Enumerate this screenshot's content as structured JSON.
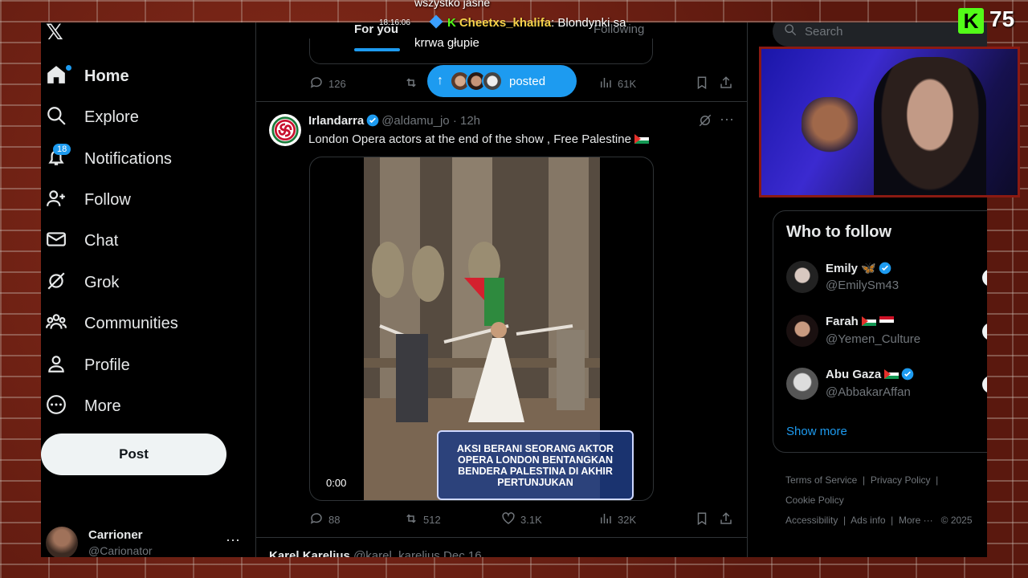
{
  "nav": {
    "items": [
      {
        "label": "Home",
        "icon": "home-icon"
      },
      {
        "label": "Explore",
        "icon": "search-icon"
      },
      {
        "label": "Notifications",
        "icon": "bell-icon",
        "badge": "18"
      },
      {
        "label": "Follow",
        "icon": "follow-icon"
      },
      {
        "label": "Chat",
        "icon": "mail-icon"
      },
      {
        "label": "Grok",
        "icon": "grok-icon"
      },
      {
        "label": "Communities",
        "icon": "communities-icon"
      },
      {
        "label": "Profile",
        "icon": "profile-icon"
      },
      {
        "label": "More",
        "icon": "more-circle-icon"
      }
    ],
    "post_label": "Post",
    "account": {
      "name": "Carrioner",
      "handle": "@Carionator"
    }
  },
  "tabs": {
    "for_you": "For you",
    "following": "Following"
  },
  "prev_tweet": {
    "replies": "126",
    "views": "61K"
  },
  "posted_pill": {
    "label": "posted"
  },
  "tweet": {
    "name": "Irlandarra",
    "handle": "@aldamu_jo",
    "time": "12h",
    "text": "London Opera actors at the end of the show , Free Palestine",
    "video_caption": "AKSI BERANI SEORANG AKTOR OPERA LONDON BENTANGKAN BENDERA PALESTINA DI AKHIR PERTUNJUKAN",
    "video_time": "0:00",
    "replies": "88",
    "reposts": "512",
    "likes": "3.1K",
    "views": "32K"
  },
  "next_tweet": {
    "name": "Karel Karelius",
    "handle": "@karel_karelius",
    "time": "Dec 16"
  },
  "search": {
    "placeholder": "Search"
  },
  "who_to_follow": {
    "title": "Who to follow",
    "accounts": [
      {
        "name": "Emily 🦋",
        "handle": "@EmilySm43"
      },
      {
        "name": "Farah",
        "handle": "@Yemen_Culture"
      },
      {
        "name": "Abu Gaza",
        "handle": "@AbbakarAffan"
      }
    ],
    "show_more": "Show more"
  },
  "footer": {
    "links": [
      "Terms of Service",
      "Privacy Policy",
      "Cookie Policy",
      "Accessibility",
      "Ads info",
      "More ···",
      "© 2025"
    ]
  },
  "overlay": {
    "chat_top": "wszystko jasne",
    "chat_time": "18:16:06",
    "chat_user": "Cheetxs_khalifa",
    "chat_msg": ": Blondynki sa",
    "chat_msg2": "krrwa głupie",
    "viewer_count": "75",
    "k_logo": "K"
  },
  "colors": {
    "accent": "#1d9bf0",
    "kick_green": "#53fc18",
    "bg": "#000000",
    "border": "#2f3336"
  }
}
